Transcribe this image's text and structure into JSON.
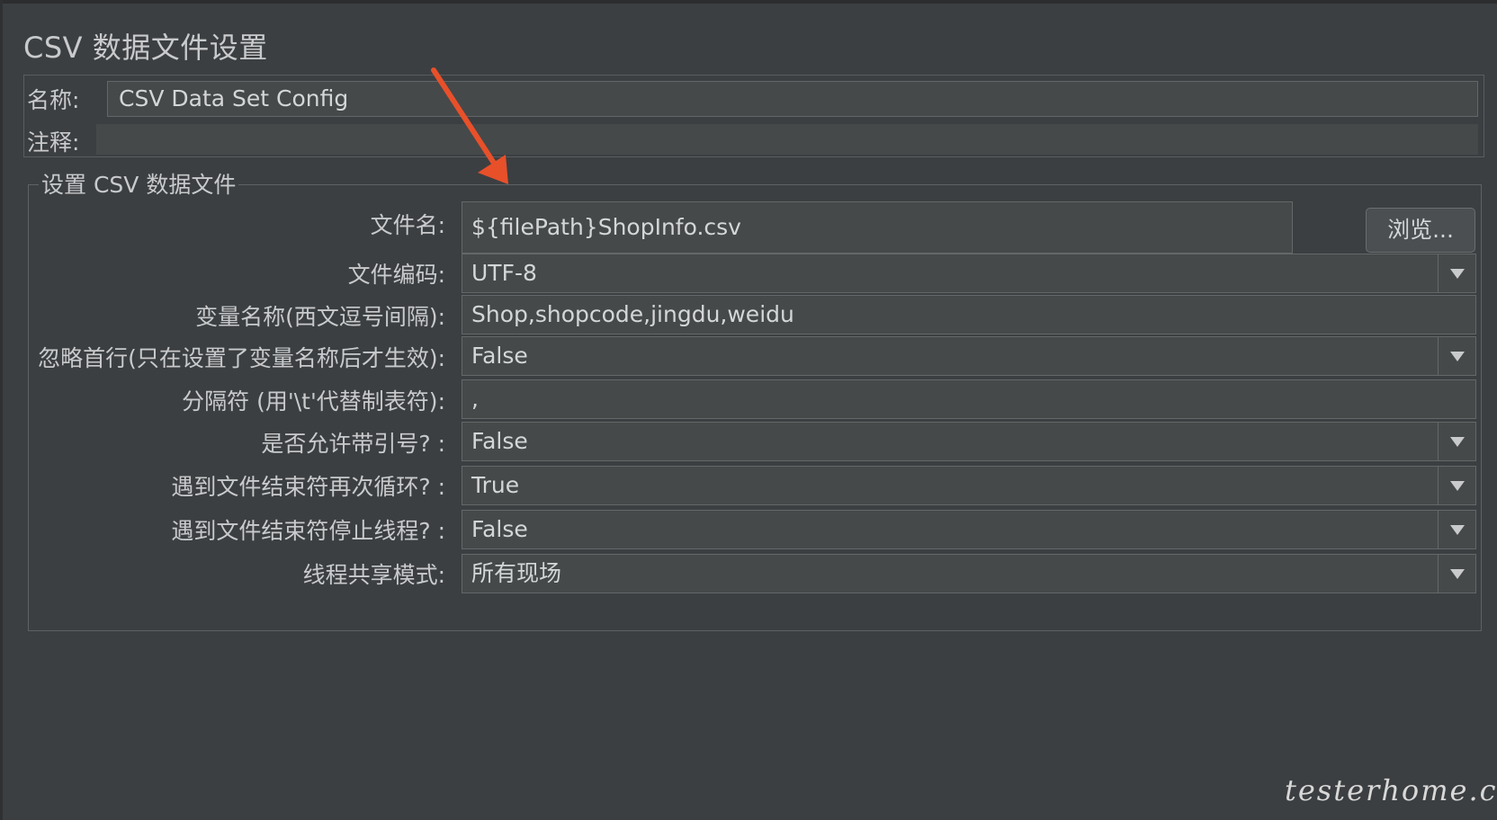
{
  "page": {
    "title": "CSV 数据文件设置"
  },
  "name_panel": {
    "name_label": "名称:",
    "name_value": "CSV Data Set Config",
    "comment_label": "注释:",
    "comment_value": ""
  },
  "csv_group": {
    "legend": "设置 CSV 数据文件",
    "filename": {
      "label": "文件名:",
      "value": "${filePath}ShopInfo.csv",
      "browse_label": "浏览..."
    },
    "encoding": {
      "label": "文件编码:",
      "value": "UTF-8"
    },
    "variable_names": {
      "label": "变量名称(西文逗号间隔):",
      "value": "Shop,shopcode,jingdu,weidu"
    },
    "ignore_first_line": {
      "label": "忽略首行(只在设置了变量名称后才生效):",
      "value": "False"
    },
    "delimiter": {
      "label": "分隔符 (用'\\t'代替制表符):",
      "value": ","
    },
    "allow_quoted": {
      "label": "是否允许带引号? :",
      "value": "False"
    },
    "recycle_on_eof": {
      "label": "遇到文件结束符再次循环? :",
      "value": "True"
    },
    "stop_thread_on_eof": {
      "label": "遇到文件结束符停止线程? :",
      "value": "False"
    },
    "sharing_mode": {
      "label": "线程共享模式:",
      "value": "所有现场"
    }
  },
  "annotation": {
    "arrow_color": "#e8502a"
  },
  "watermark": {
    "text": "testerhome.com"
  },
  "colors": {
    "background": "#3c3f41",
    "field_background": "#45494a",
    "text": "#d4d6d8"
  }
}
